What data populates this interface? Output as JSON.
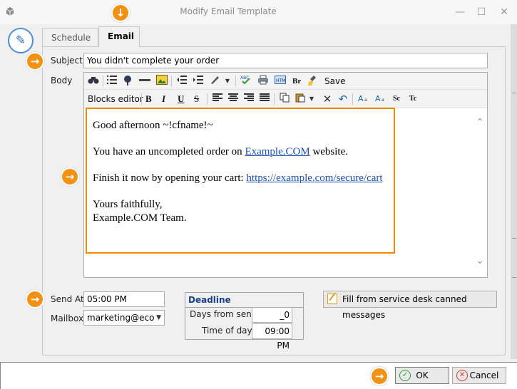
{
  "window": {
    "title": "Modify Email Template",
    "app_icon": "app-icon",
    "minimize": "—",
    "maximize": "☐",
    "close": "✕"
  },
  "tabs": [
    {
      "label": "Schedule",
      "active": false
    },
    {
      "label": "Email",
      "active": true
    }
  ],
  "form": {
    "subject_label": "Subject",
    "subject_value": "You didn't complete your order",
    "body_label": "Body",
    "send_at_label": "Send At",
    "send_at_value": "05:00 PM",
    "mailbox_label": "Mailbox",
    "mailbox_value": "marketing@eco"
  },
  "toolbar": {
    "row1": {
      "icons": [
        "binoculars-icon",
        "bullet-list-icon",
        "insert-link-icon",
        "horizontal-rule-icon",
        "insert-image-icon",
        "decrease-indent-icon",
        "increase-indent-icon",
        "highlighter-icon",
        "spellcheck-icon",
        "print-icon",
        "html-icon"
      ],
      "br_label": "Br",
      "save_label": "Save"
    },
    "row2": {
      "blocks_editor_label": "Blocks editor",
      "bold": "B",
      "italic": "I",
      "underline": "U",
      "strike": "S",
      "superscript": "Sc",
      "text_case": "Tc"
    }
  },
  "body": {
    "greeting": "Good afternoon ~!cfname!~",
    "line2_prefix": "You have an uncompleted order on ",
    "line2_link": "Example.COM",
    "line2_suffix": " website.",
    "line3_prefix": "Finish it now by opening your cart: ",
    "line3_link": "https://example.com/secure/cart",
    "closing": "Yours faithfully,",
    "signature": "Example.COM Team."
  },
  "deadline": {
    "title": "Deadline",
    "days_label": "Days from sent",
    "days_value": "_0",
    "time_label": "Time of day",
    "time_value": "09:00 PM"
  },
  "buttons": {
    "canned": "Fill from service desk canned messages",
    "ok": "OK",
    "cancel": "Cancel"
  },
  "colors": {
    "accent_orange": "#f39113",
    "link_blue": "#1a4fb6",
    "deadline_title": "#1a3e8a"
  }
}
